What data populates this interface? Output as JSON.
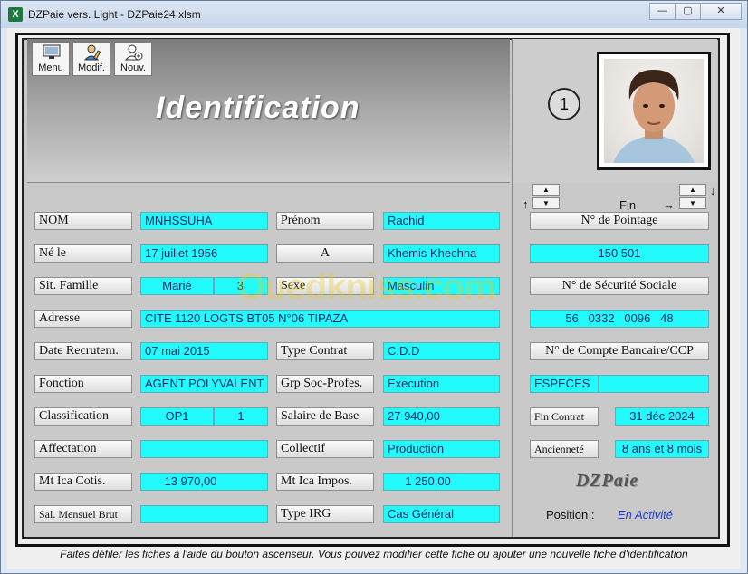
{
  "window": {
    "title": "DZPaie vers. Light - DZPaie24.xlsm",
    "app_icon": "X",
    "controls": {
      "minimize": "—",
      "maximize": "▢",
      "close": "✕"
    }
  },
  "toolbar": [
    {
      "label": "Menu",
      "icon": "monitor-icon"
    },
    {
      "label": "Modif.",
      "icon": "user-edit-icon"
    },
    {
      "label": "Nouv.",
      "icon": "user-add-icon"
    }
  ],
  "header": {
    "title": "Identification"
  },
  "record": {
    "number": "1",
    "nav_label": "Fin",
    "up_arrow": "↑",
    "down_arrow": "↓",
    "right_arrow": "→",
    "spin_up": "▲",
    "spin_down": "▼"
  },
  "left_labels": [
    "NOM",
    "Né le",
    "Sit. Famille",
    "Adresse",
    "Date Recrutem.",
    "Fonction",
    "Classification",
    "Affectation",
    "Mt Ica Cotis.",
    "Sal. Mensuel Brut"
  ],
  "left_values": {
    "nom": "MNHSSUHA",
    "ne_le": "17 juillet 1956",
    "sit_famille": "Marié",
    "sit_famille_count": "3",
    "adresse": "CITE 1120 LOGTS BT05 N°06 TIPAZA",
    "date_recrutem": "07 mai 2015",
    "fonction": "AGENT POLYVALENT",
    "classification": "OP1",
    "classification_level": "1",
    "affectation": "",
    "mt_ica_cotis": "13 970,00",
    "sal_mensuel_brut": ""
  },
  "mid_labels": [
    "Prénom",
    "A",
    "Sexe",
    "Type Contrat",
    "Grp Soc-Profes.",
    "Salaire de Base",
    "Collectif",
    "Mt Ica Impos.",
    "Type IRG"
  ],
  "mid_values": {
    "prenom": "Rachid",
    "lieu": "Khemis Khechna",
    "sexe": "Masculin",
    "type_contrat": "C.D.D",
    "grp_soc": "Execution",
    "salaire_base": "27 940,00",
    "collectif": "Production",
    "mt_ica_impos": "1 250,00",
    "type_irg": "Cas Général"
  },
  "right_panel": {
    "pointage_label": "N° de Pointage",
    "pointage_value": "150 501",
    "secu_label": "N° de Sécurité Sociale",
    "secu_value": "56   0332   0096   48",
    "compte_label": "N° de Compte Bancaire/CCP",
    "compte_value": "ESPECES",
    "fin_contrat_label": "Fin Contrat",
    "fin_contrat_value": "31 déc 2024",
    "anciennete_label": "Ancienneté",
    "anciennete_value": "8 ans et 8 mois",
    "logo": "DZPaie",
    "position_label": "Position :",
    "position_value": "En Activité"
  },
  "watermark": "Ouedkniss.com",
  "status": "Faites défiler les fiches à l'aide du bouton ascenseur. Vous pouvez modifier cette fiche ou ajouter une nouvelle fiche d'identification",
  "colors": {
    "field_bg": "#22fbfb",
    "field_text": "#0b2c6b",
    "position_text": "#1f3fd6"
  }
}
